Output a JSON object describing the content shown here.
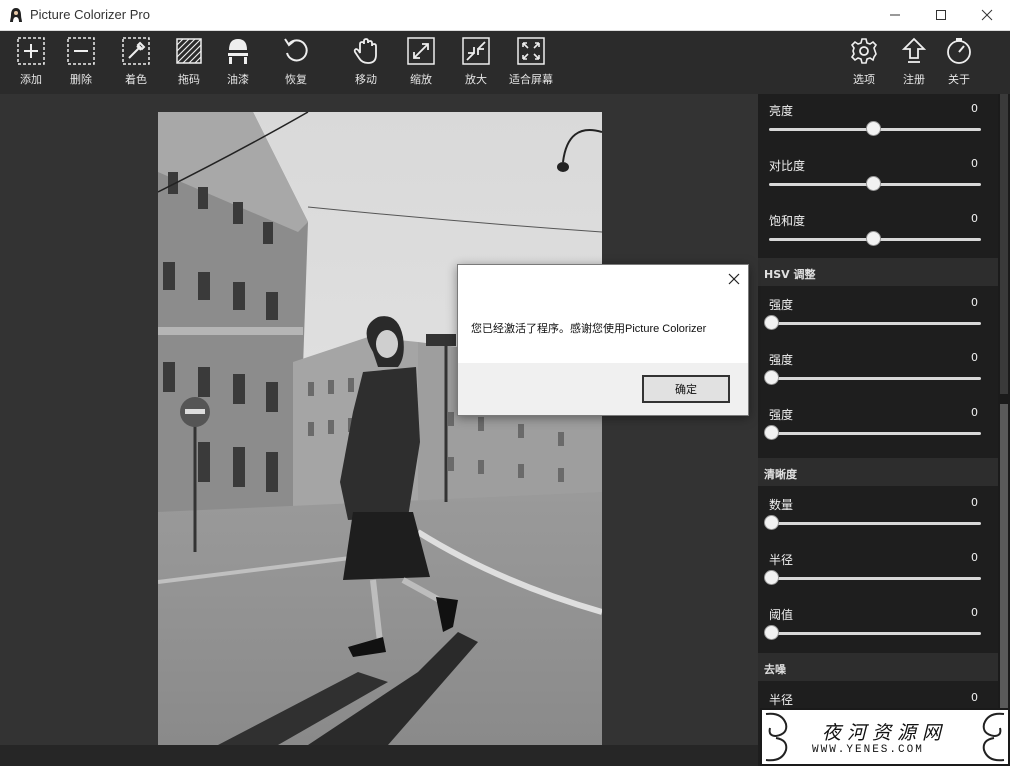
{
  "window": {
    "title": "Picture Colorizer Pro"
  },
  "toolbar": {
    "tools": [
      {
        "label": "添加",
        "icon": "add-icon"
      },
      {
        "label": "删除",
        "icon": "remove-icon"
      },
      {
        "label": "着色",
        "icon": "colorize-icon"
      },
      {
        "label": "拖码",
        "icon": "crop-icon"
      },
      {
        "label": "油漆",
        "icon": "paint-icon"
      },
      {
        "label": "恢复",
        "icon": "restore-icon"
      },
      {
        "label": "移动",
        "icon": "hand-icon"
      },
      {
        "label": "缩放",
        "icon": "zoom-out-icon"
      },
      {
        "label": "放大",
        "icon": "zoom-in-icon"
      },
      {
        "label": "适合屏幕",
        "icon": "fit-screen-icon"
      }
    ],
    "right_tools": [
      {
        "label": "选项",
        "icon": "gear-icon"
      },
      {
        "label": "注册",
        "icon": "register-icon"
      },
      {
        "label": "关于",
        "icon": "compass-icon"
      }
    ]
  },
  "panel": {
    "basic": [
      {
        "label": "亮度",
        "value": "0",
        "level": 0.5
      },
      {
        "label": "对比度",
        "value": "0",
        "level": 0.5
      },
      {
        "label": "饱和度",
        "value": "0",
        "level": 0.5
      }
    ],
    "hsv_title": "HSV 调整",
    "hsv": [
      {
        "label": "强度",
        "value": "0",
        "level": 0
      },
      {
        "label": "强度",
        "value": "0",
        "level": 0
      },
      {
        "label": "强度",
        "value": "0",
        "level": 0
      }
    ],
    "sharpen_title": "清晰度",
    "sharpen": [
      {
        "label": "数量",
        "value": "0",
        "level": 0
      },
      {
        "label": "半径",
        "value": "0",
        "level": 0
      },
      {
        "label": "阈值",
        "value": "0",
        "level": 0
      }
    ],
    "denoise_title": "去噪",
    "denoise": [
      {
        "label": "半径",
        "value": "0",
        "level": 0
      }
    ]
  },
  "dialog": {
    "message": "您已经激活了程序。感谢您使用Picture Colorizer",
    "ok_label": "确定"
  },
  "watermark": {
    "text": "夜河资源网",
    "url": "WWW.YENES.COM"
  }
}
